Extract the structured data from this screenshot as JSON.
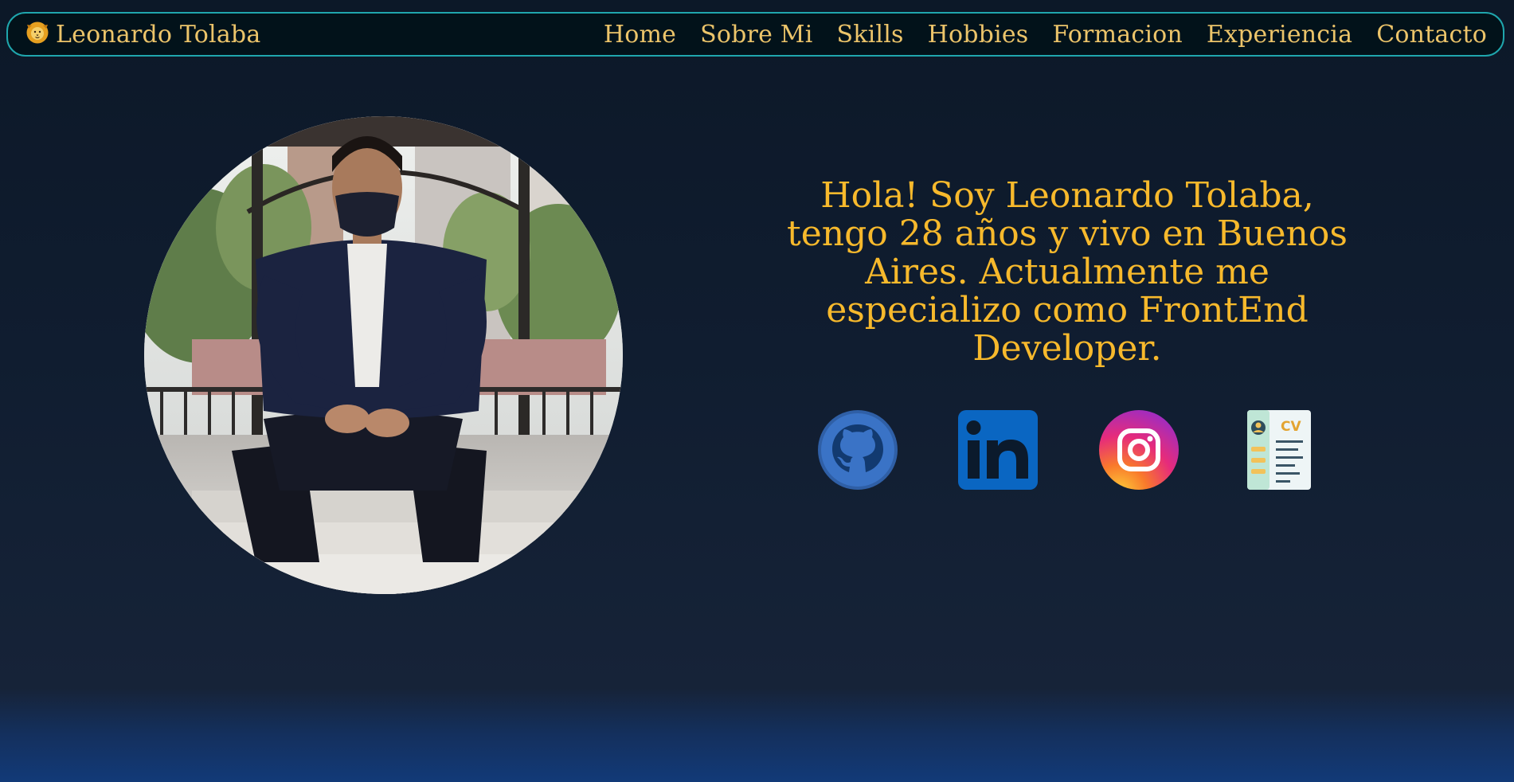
{
  "brand": {
    "name": "Leonardo Tolaba",
    "icon": "lion-icon"
  },
  "nav": {
    "items": [
      {
        "label": "Home"
      },
      {
        "label": "Sobre Mi"
      },
      {
        "label": "Skills"
      },
      {
        "label": "Hobbies"
      },
      {
        "label": "Formacion"
      },
      {
        "label": "Experiencia"
      },
      {
        "label": "Contacto"
      }
    ]
  },
  "hero": {
    "text": "Hola! Soy Leonardo Tolaba, tengo 28 años y vivo en Buenos Aires. Actualmente me especializo como FrontEnd Developer."
  },
  "social": {
    "items": [
      {
        "icon": "github-icon"
      },
      {
        "icon": "linkedin-icon"
      },
      {
        "icon": "instagram-icon"
      },
      {
        "icon": "cv-icon",
        "text": "CV"
      }
    ]
  },
  "colors": {
    "accent": "#ecc46a",
    "hero_text": "#f7b92c",
    "nav_border": "#1fa6ad",
    "nav_background": "#02121a",
    "page_background": "#101d30"
  }
}
